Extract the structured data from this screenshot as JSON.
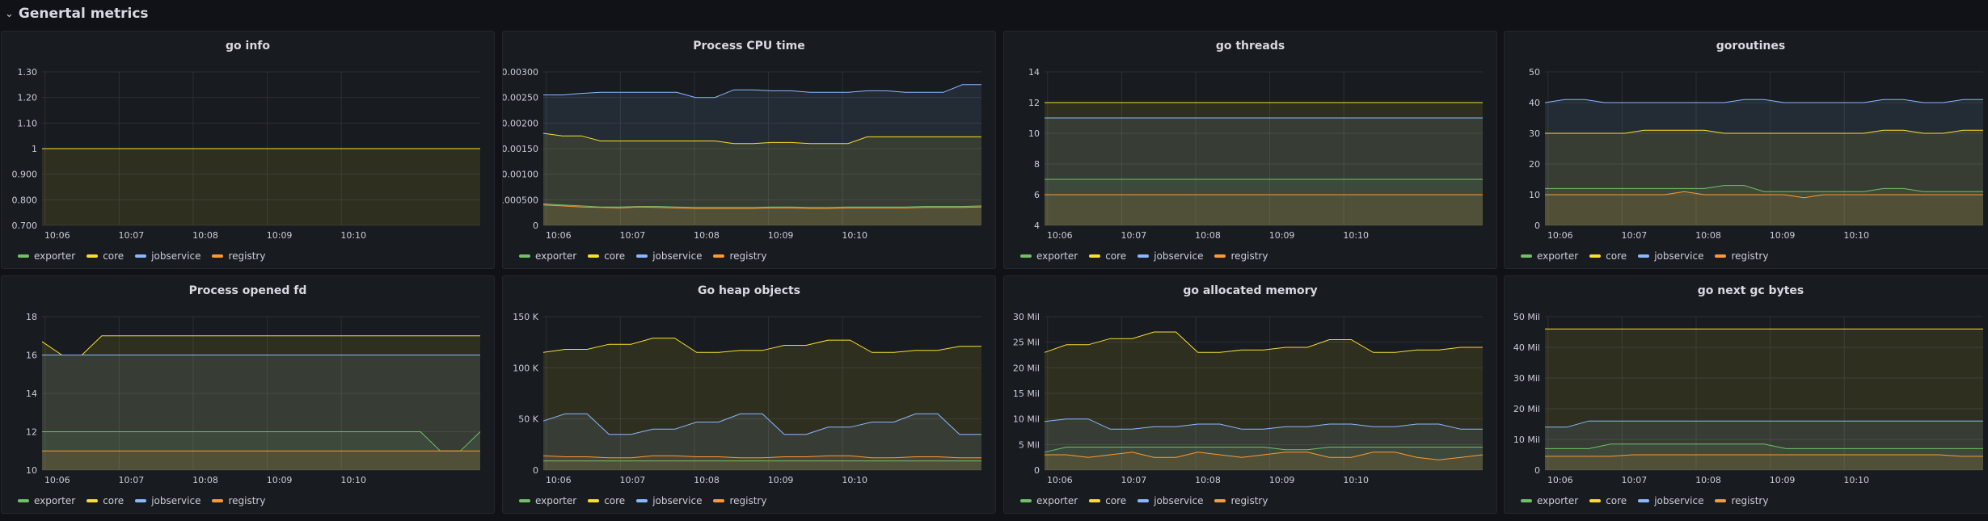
{
  "row_title": "Genertal metrics",
  "legend_labels": [
    "exporter",
    "core",
    "jobservice",
    "registry"
  ],
  "series_colors": {
    "exporter": "#73bf69",
    "core": "#fade2a",
    "jobservice": "#8ab8ff",
    "registry": "#ff9830"
  },
  "chart_data": [
    {
      "type": "area",
      "title": "go info",
      "x": [
        "10:06",
        "10:07",
        "10:08",
        "10:09",
        "10:10"
      ],
      "y_ticks": [
        "0.700",
        "0.800",
        "0.900",
        "1",
        "1.10",
        "1.20",
        "1.30"
      ],
      "ylim": [
        0.7,
        1.3
      ],
      "series": [
        {
          "name": "core",
          "values": [
            1,
            1,
            1,
            1,
            1,
            1,
            1,
            1,
            1,
            1,
            1,
            1,
            1,
            1,
            1,
            1,
            1,
            1,
            1,
            1,
            1,
            1,
            1,
            1,
            1
          ]
        }
      ]
    },
    {
      "type": "area",
      "title": "Process CPU time",
      "x": [
        "10:06",
        "10:07",
        "10:08",
        "10:09",
        "10:10"
      ],
      "y_ticks": [
        "0",
        "0.000500",
        "0.00100",
        "0.00150",
        "0.00200",
        "0.00250",
        "0.00300"
      ],
      "ylim": [
        0,
        0.003
      ],
      "series": [
        {
          "name": "jobservice",
          "values": [
            0.00255,
            0.00255,
            0.00258,
            0.0026,
            0.0026,
            0.0026,
            0.0026,
            0.0026,
            0.0025,
            0.0025,
            0.00265,
            0.00265,
            0.00263,
            0.00263,
            0.0026,
            0.0026,
            0.0026,
            0.00263,
            0.00263,
            0.0026,
            0.0026,
            0.0026,
            0.00275,
            0.00275
          ]
        },
        {
          "name": "core",
          "values": [
            0.0018,
            0.00175,
            0.00175,
            0.00165,
            0.00165,
            0.00165,
            0.00165,
            0.00165,
            0.00165,
            0.00165,
            0.0016,
            0.0016,
            0.00162,
            0.00162,
            0.0016,
            0.0016,
            0.0016,
            0.00173,
            0.00173,
            0.00173,
            0.00173,
            0.00173,
            0.00173,
            0.00173
          ]
        },
        {
          "name": "exporter",
          "values": [
            0.00042,
            0.0004,
            0.00038,
            0.00036,
            0.00036,
            0.00037,
            0.00037,
            0.00036,
            0.00035,
            0.00035,
            0.00035,
            0.00035,
            0.00036,
            0.00036,
            0.00035,
            0.00035,
            0.00036,
            0.00036,
            0.00036,
            0.00036,
            0.00037,
            0.00037,
            0.00037,
            0.00038
          ]
        },
        {
          "name": "registry",
          "values": [
            0.0004,
            0.00038,
            0.00036,
            0.00035,
            0.00034,
            0.00036,
            0.00035,
            0.00034,
            0.00033,
            0.00033,
            0.00033,
            0.00033,
            0.00034,
            0.00034,
            0.00033,
            0.00033,
            0.00034,
            0.00034,
            0.00034,
            0.00034,
            0.00035,
            0.00035,
            0.00035,
            0.00036
          ]
        }
      ]
    },
    {
      "type": "area",
      "title": "go threads",
      "x": [
        "10:06",
        "10:07",
        "10:08",
        "10:09",
        "10:10"
      ],
      "y_ticks": [
        "4",
        "6",
        "8",
        "10",
        "12",
        "14"
      ],
      "ylim": [
        4,
        14
      ],
      "series": [
        {
          "name": "core",
          "values": [
            12,
            12,
            12,
            12,
            12,
            12,
            12,
            12,
            12,
            12,
            12,
            12,
            12,
            12,
            12,
            12,
            12,
            12,
            12,
            12
          ]
        },
        {
          "name": "jobservice",
          "values": [
            11,
            11,
            11,
            11,
            11,
            11,
            11,
            11,
            11,
            11,
            11,
            11,
            11,
            11,
            11,
            11,
            11,
            11,
            11,
            11
          ]
        },
        {
          "name": "exporter",
          "values": [
            7,
            7,
            7,
            7,
            7,
            7,
            7,
            7,
            7,
            7,
            7,
            7,
            7,
            7,
            7,
            7,
            7,
            7,
            7,
            7
          ]
        },
        {
          "name": "registry",
          "values": [
            6,
            6,
            6,
            6,
            6,
            6,
            6,
            6,
            6,
            6,
            6,
            6,
            6,
            6,
            6,
            6,
            6,
            6,
            6,
            6
          ]
        }
      ]
    },
    {
      "type": "area",
      "title": "goroutines",
      "x": [
        "10:06",
        "10:07",
        "10:08",
        "10:09",
        "10:10"
      ],
      "y_ticks": [
        "0",
        "10",
        "20",
        "30",
        "40",
        "50"
      ],
      "ylim": [
        0,
        50
      ],
      "series": [
        {
          "name": "jobservice",
          "values": [
            40,
            41,
            41,
            40,
            40,
            40,
            40,
            40,
            40,
            40,
            41,
            41,
            40,
            40,
            40,
            40,
            40,
            41,
            41,
            40,
            40,
            41,
            41
          ]
        },
        {
          "name": "core",
          "values": [
            30,
            30,
            30,
            30,
            30,
            31,
            31,
            31,
            31,
            30,
            30,
            30,
            30,
            30,
            30,
            30,
            30,
            31,
            31,
            30,
            30,
            31,
            31
          ]
        },
        {
          "name": "exporter",
          "values": [
            12,
            12,
            12,
            12,
            12,
            12,
            12,
            12,
            12,
            13,
            13,
            11,
            11,
            11,
            11,
            11,
            11,
            12,
            12,
            11,
            11,
            11,
            11
          ]
        },
        {
          "name": "registry",
          "values": [
            10,
            10,
            10,
            10,
            10,
            10,
            10,
            11,
            10,
            10,
            10,
            10,
            10,
            9,
            10,
            10,
            10,
            10,
            10,
            10,
            10,
            10,
            10
          ]
        }
      ]
    },
    {
      "type": "area",
      "title": "Process opened fd",
      "x": [
        "10:06",
        "10:07",
        "10:08",
        "10:09",
        "10:10"
      ],
      "y_ticks": [
        "10",
        "12",
        "14",
        "16",
        "18"
      ],
      "ylim": [
        10,
        18
      ],
      "series": [
        {
          "name": "core",
          "values": [
            16.7,
            16,
            16,
            17,
            17,
            17,
            17,
            17,
            17,
            17,
            17,
            17,
            17,
            17,
            17,
            17,
            17,
            17,
            17,
            17,
            17,
            17,
            17
          ]
        },
        {
          "name": "jobservice",
          "values": [
            16,
            16,
            16,
            16,
            16,
            16,
            16,
            16,
            16,
            16,
            16,
            16,
            16,
            16,
            16,
            16,
            16,
            16,
            16,
            16,
            16,
            16,
            16
          ]
        },
        {
          "name": "exporter",
          "values": [
            12,
            12,
            12,
            12,
            12,
            12,
            12,
            12,
            12,
            12,
            12,
            12,
            12,
            12,
            12,
            12,
            12,
            12,
            12,
            12,
            11,
            11,
            12
          ]
        },
        {
          "name": "registry",
          "values": [
            11,
            11,
            11,
            11,
            11,
            11,
            11,
            11,
            11,
            11,
            11,
            11,
            11,
            11,
            11,
            11,
            11,
            11,
            11,
            11,
            11,
            11,
            11
          ]
        }
      ]
    },
    {
      "type": "area",
      "title": "Go heap objects",
      "x": [
        "10:06",
        "10:07",
        "10:08",
        "10:09",
        "10:10"
      ],
      "y_ticks": [
        "0",
        "50 K",
        "100 K",
        "150 K"
      ],
      "ylim": [
        0,
        150000
      ],
      "series": [
        {
          "name": "core",
          "values": [
            115000,
            118000,
            118000,
            123000,
            123000,
            129000,
            129000,
            115000,
            115000,
            117000,
            117000,
            122000,
            122000,
            127000,
            127000,
            115000,
            115000,
            117000,
            117000,
            121000,
            121000
          ]
        },
        {
          "name": "jobservice",
          "values": [
            48000,
            55000,
            55000,
            35000,
            35000,
            40000,
            40000,
            47000,
            47000,
            55000,
            55000,
            35000,
            35000,
            42000,
            42000,
            47000,
            47000,
            55000,
            55000,
            35000,
            35000
          ]
        },
        {
          "name": "registry",
          "values": [
            14000,
            13000,
            13000,
            12000,
            12000,
            14000,
            14000,
            13000,
            13000,
            12000,
            12000,
            13000,
            13000,
            14000,
            14000,
            12000,
            12000,
            13000,
            13000,
            12000,
            12000
          ]
        },
        {
          "name": "exporter",
          "values": [
            9000,
            9000,
            9000,
            9000,
            9000,
            9000,
            9000,
            9000,
            9000,
            9000,
            9000,
            9000,
            9000,
            9000,
            9000,
            9000,
            9000,
            9000,
            9000,
            9000,
            9000
          ]
        }
      ]
    },
    {
      "type": "area",
      "title": "go allocated memory",
      "x": [
        "10:06",
        "10:07",
        "10:08",
        "10:09",
        "10:10"
      ],
      "y_ticks": [
        "0",
        "5 Mil",
        "10 Mil",
        "15 Mil",
        "20 Mil",
        "25 Mil",
        "30 Mil"
      ],
      "ylim": [
        0,
        30000000
      ],
      "series": [
        {
          "name": "core",
          "values": [
            23000000,
            24500000,
            24500000,
            25700000,
            25700000,
            27000000,
            27000000,
            23000000,
            23000000,
            23500000,
            23500000,
            24000000,
            24000000,
            25500000,
            25500000,
            23000000,
            23000000,
            23500000,
            23500000,
            24000000,
            24000000
          ]
        },
        {
          "name": "jobservice",
          "values": [
            9500000,
            10000000,
            10000000,
            8000000,
            8000000,
            8500000,
            8500000,
            9000000,
            9000000,
            8000000,
            8000000,
            8500000,
            8500000,
            9000000,
            9000000,
            8500000,
            8500000,
            9000000,
            9000000,
            8000000,
            8000000
          ]
        },
        {
          "name": "exporter",
          "values": [
            3500000,
            4500000,
            4500000,
            4500000,
            4500000,
            4500000,
            4500000,
            4500000,
            4500000,
            4500000,
            4500000,
            4000000,
            4000000,
            4500000,
            4500000,
            4500000,
            4500000,
            4500000,
            4500000,
            4500000,
            4500000
          ]
        },
        {
          "name": "registry",
          "values": [
            3000000,
            3000000,
            2500000,
            3000000,
            3500000,
            2500000,
            2500000,
            3500000,
            3000000,
            2500000,
            3000000,
            3500000,
            3500000,
            2500000,
            2500000,
            3500000,
            3500000,
            2500000,
            2000000,
            2500000,
            3000000
          ]
        }
      ]
    },
    {
      "type": "area",
      "title": "go next gc bytes",
      "x": [
        "10:06",
        "10:07",
        "10:08",
        "10:09",
        "10:10"
      ],
      "y_ticks": [
        "0",
        "10 Mil",
        "20 Mil",
        "30 Mil",
        "40 Mil",
        "50 Mil"
      ],
      "ylim": [
        0,
        50000000
      ],
      "series": [
        {
          "name": "core",
          "values": [
            46000000,
            46000000,
            46000000,
            46000000,
            46000000,
            46000000,
            46000000,
            46000000,
            46000000,
            46000000,
            46000000,
            46000000,
            46000000,
            46000000,
            46000000,
            46000000,
            46000000,
            46000000,
            46000000,
            46000000,
            46000000
          ]
        },
        {
          "name": "jobservice",
          "values": [
            14000000,
            14000000,
            16000000,
            16000000,
            16000000,
            16000000,
            16000000,
            16000000,
            16000000,
            16000000,
            16000000,
            16000000,
            16000000,
            16000000,
            16000000,
            16000000,
            16000000,
            16000000,
            16000000,
            16000000,
            16000000
          ]
        },
        {
          "name": "exporter",
          "values": [
            7000000,
            7000000,
            7000000,
            8500000,
            8500000,
            8500000,
            8500000,
            8500000,
            8500000,
            8500000,
            8500000,
            7000000,
            7000000,
            7000000,
            7000000,
            7000000,
            7000000,
            7000000,
            7000000,
            7000000,
            7000000
          ]
        },
        {
          "name": "registry",
          "values": [
            4500000,
            4500000,
            4500000,
            4500000,
            5000000,
            5000000,
            5000000,
            5000000,
            5000000,
            5000000,
            5000000,
            5000000,
            5000000,
            5000000,
            5000000,
            5000000,
            5000000,
            5000000,
            5000000,
            4500000,
            4500000
          ]
        }
      ]
    }
  ]
}
